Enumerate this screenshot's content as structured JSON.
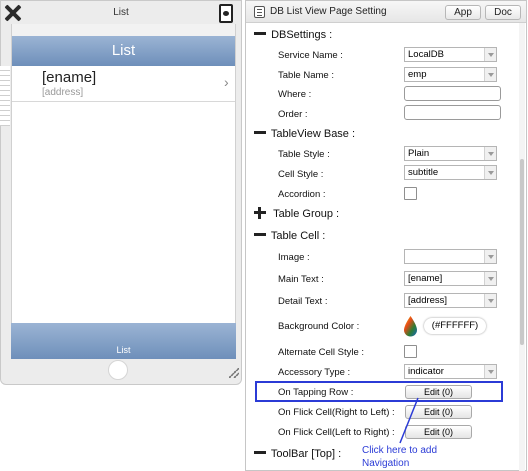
{
  "phone": {
    "title": "List",
    "nav_title": "List",
    "cell_main": "[ename]",
    "cell_detail": "[address]",
    "cell_chevron": "›",
    "toolbar_label": "List"
  },
  "panel": {
    "title": "DB List View Page Setting",
    "app_button": "App",
    "doc_button": "Doc"
  },
  "sections": {
    "db_settings": "DBSettings :",
    "tableview_base": "TableView Base :",
    "table_group": "Table Group :",
    "table_cell": "Table Cell :",
    "toolbar_top": "ToolBar [Top] :"
  },
  "fields": {
    "service_name": {
      "label": "Service Name :",
      "value": "LocalDB"
    },
    "table_name": {
      "label": "Table Name :",
      "value": "emp"
    },
    "where": {
      "label": "Where :",
      "value": ""
    },
    "order": {
      "label": "Order :",
      "value": ""
    },
    "table_style": {
      "label": "Table Style :",
      "value": "Plain"
    },
    "cell_style": {
      "label": "Cell Style :",
      "value": "subtitle"
    },
    "accordion": {
      "label": "Accordion :"
    },
    "image": {
      "label": "Image :",
      "value": ""
    },
    "main_text": {
      "label": "Main Text :",
      "value": "[ename]"
    },
    "detail_text": {
      "label": "Detail Text :",
      "value": "[address]"
    },
    "background_color": {
      "label": "Background Color :",
      "value": "(#FFFFFF)"
    },
    "alternate_cell_style": {
      "label": "Alternate Cell Style :"
    },
    "accessory_type": {
      "label": "Accessory Type :",
      "value": "indicator"
    },
    "on_tapping_row": {
      "label": "On Tapping Row :",
      "button": "Edit (0)"
    },
    "on_flick_right_to_left": {
      "label": "On Flick Cell(Right to Left) :",
      "button": "Edit (0)"
    },
    "on_flick_left_to_right": {
      "label": "On Flick Cell(Left to Right) :",
      "button": "Edit (0)"
    }
  },
  "annotation": {
    "line1": "Click here to add",
    "line2": "Navigation",
    "color": "#2b3bd6"
  },
  "colors": {
    "nav_bar": "#7f9dc6",
    "highlight": "#2b3bd6"
  }
}
